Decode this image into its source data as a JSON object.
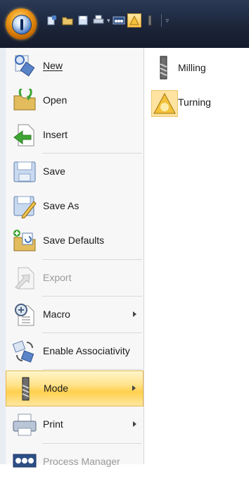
{
  "quick_access": {
    "icons": [
      "document-tools-icon",
      "open-folder-icon",
      "save-icon",
      "print-icon",
      "dropdown-arrow-icon",
      "process-manager-icon",
      "turning-icon",
      "milling-tool-icon",
      "customize-dropdown-icon"
    ]
  },
  "menu": {
    "items": [
      {
        "label": "New",
        "mnemonic": "N",
        "enabled": true,
        "submenu": false,
        "icon": "new-tool-icon"
      },
      {
        "label": "Open",
        "mnemonic": "O",
        "enabled": true,
        "submenu": false,
        "icon": "open-folder-icon"
      },
      {
        "label": "Insert",
        "mnemonic": "I",
        "enabled": true,
        "submenu": false,
        "icon": "insert-document-icon"
      },
      {
        "label": "Save",
        "mnemonic": "S",
        "enabled": true,
        "submenu": false,
        "icon": "save-icon"
      },
      {
        "label": "Save As",
        "mnemonic": "A",
        "enabled": true,
        "submenu": false,
        "icon": "save-as-icon"
      },
      {
        "label": "Save Defaults",
        "mnemonic": "f",
        "enabled": true,
        "submenu": false,
        "icon": "save-defaults-icon"
      },
      {
        "label": "Export",
        "mnemonic": "E",
        "enabled": false,
        "submenu": false,
        "icon": "export-icon"
      },
      {
        "label": "Macro",
        "mnemonic": "M",
        "enabled": true,
        "submenu": true,
        "icon": "macro-icon"
      },
      {
        "label": "Enable Associativity",
        "mnemonic": "b",
        "enabled": true,
        "submenu": false,
        "icon": "associativity-icon"
      },
      {
        "label": "Mode",
        "mnemonic": "",
        "enabled": true,
        "submenu": true,
        "highlighted": true,
        "icon": "milling-tool-icon"
      },
      {
        "label": "Print",
        "mnemonic": "P",
        "enabled": true,
        "submenu": true,
        "icon": "print-icon"
      },
      {
        "label": "Process Manager",
        "mnemonic": "",
        "enabled": false,
        "submenu": false,
        "icon": "process-manager-icon"
      }
    ]
  },
  "submenu": {
    "items": [
      {
        "label": "Milling",
        "icon": "milling-tool-icon"
      },
      {
        "label": "Turning",
        "icon": "turning-icon",
        "selected": true
      }
    ]
  },
  "colors": {
    "title_bar": "#1b2438",
    "highlight": "#ffd04e",
    "disabled_text": "#9a9a9a",
    "accent_green": "#3fa534"
  }
}
